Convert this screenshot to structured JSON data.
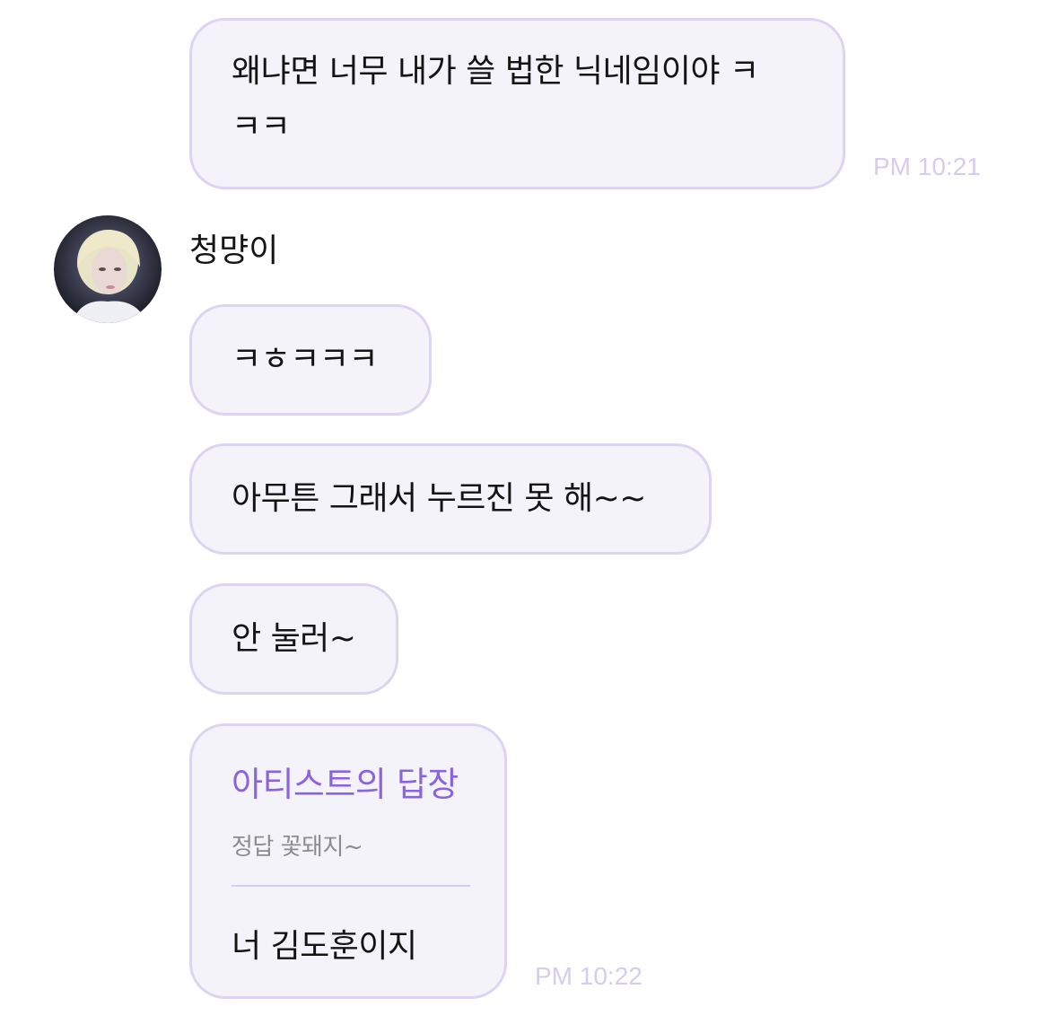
{
  "messages": {
    "msg1": {
      "line1": "왜냐면 너무 내가 쓸 법한 닉네임이야 ㅋ",
      "line2": "ㅋㅋ",
      "time": "PM 10:21"
    },
    "sender_name": "청먕이",
    "msg2": {
      "text": "ㅋㅎㅋㅋㅋ"
    },
    "msg3": {
      "text": "아무튼 그래서 누르진 못 해~~"
    },
    "msg4": {
      "text": "안 눌러~"
    },
    "reply": {
      "title": "아티스트의 답장",
      "quote": "정답 꽃돼지~",
      "text": "너 김도훈이지",
      "time": "PM 10:22"
    }
  },
  "colors": {
    "bubble_bg": "#f4f3f9",
    "bubble_border": "#ddd3f3",
    "accent": "#8a63e3",
    "timestamp": "#d6ccef"
  },
  "icons": {
    "avatar": "artist-profile-photo"
  }
}
